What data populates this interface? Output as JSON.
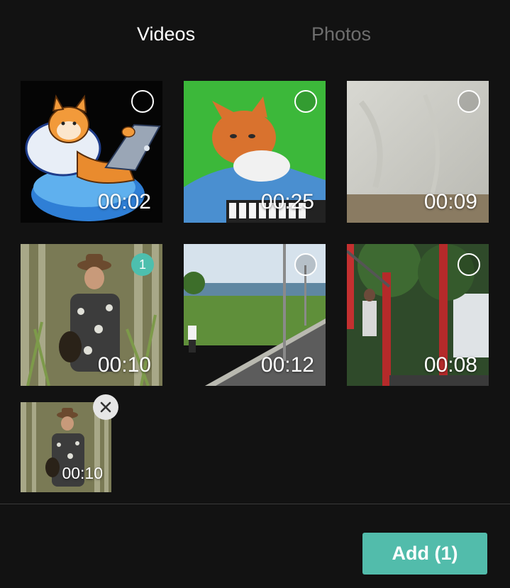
{
  "tabs": {
    "videos": "Videos",
    "photos": "Photos"
  },
  "grid": [
    {
      "duration": "00:02",
      "subject": "cartoon shiba dog with laptop on pillow",
      "selected": false
    },
    {
      "duration": "00:25",
      "subject": "orange cat typing on keyboard, green screen",
      "selected": false
    },
    {
      "duration": "00:09",
      "subject": "pale grey fabric background",
      "selected": false
    },
    {
      "duration": "00:10",
      "subject": "man with hat playing guitar",
      "selected": true,
      "selection_number": "1"
    },
    {
      "duration": "00:12",
      "subject": "seaside promenade with person",
      "selected": false
    },
    {
      "duration": "00:08",
      "subject": "person on red outdoor gym bars under trees",
      "selected": false
    }
  ],
  "selected_tray": [
    {
      "duration": "00:10"
    }
  ],
  "add_button": "Add (1)",
  "colors": {
    "background": "#121212",
    "accent": "#52bcab",
    "inactive_tab": "#6e6e6e"
  }
}
